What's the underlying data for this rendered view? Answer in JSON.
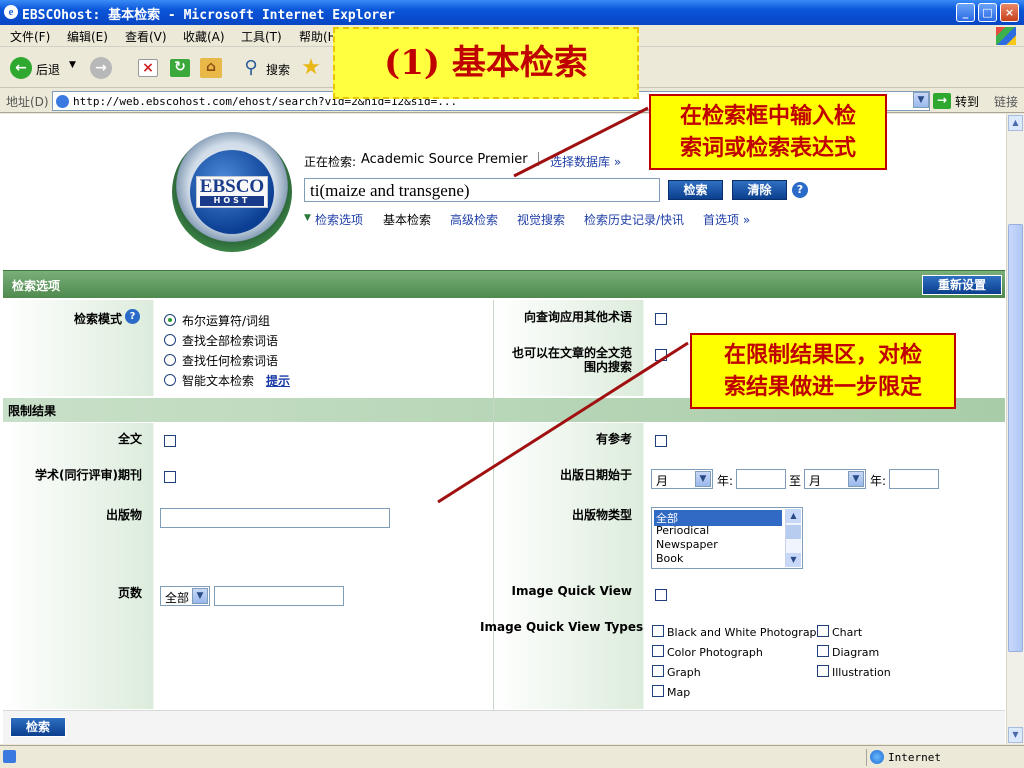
{
  "window": {
    "title": "EBSCOhost: 基本检索 - Microsoft Internet Explorer"
  },
  "menu": [
    "文件(F)",
    "编辑(E)",
    "查看(V)",
    "收藏(A)",
    "工具(T)",
    "帮助(H)"
  ],
  "toolbar": {
    "back": "后退",
    "search": "搜索"
  },
  "address": {
    "label": "地址(D)",
    "url": "http://web.ebscohost.com/ehost/search?vid=2&hid=12&sid=...",
    "go": "转到",
    "links": "链接"
  },
  "header": {
    "searching_label": "正在检索:",
    "database": "Academic Source Premier",
    "choose_db": "选择数据库 »",
    "query": "ti(maize and transgene)",
    "search_btn": "检索",
    "clear_btn": "清除",
    "help": "?",
    "nav": [
      "检索选项",
      "基本检索",
      "高级检索",
      "视觉搜索",
      "检索历史记录/快讯",
      "首选项 »"
    ]
  },
  "search_options": {
    "title": "检索选项",
    "reset": "重新设置",
    "mode_label": "检索模式",
    "modes": [
      "布尔运算符/词组",
      "查找全部检索词语",
      "查找任何检索词语",
      "智能文本检索"
    ],
    "hint": "提示",
    "apply_related": "向查询应用其他术语",
    "fulltext_search_1": "也可以在文章的全文范",
    "fulltext_search_2": "围内搜索"
  },
  "limits": {
    "title": "限制结果",
    "fulltext": "全文",
    "has_refs": "有参考",
    "peer_reviewed": "学术(同行评审)期刊",
    "pub_date": "出版日期始于",
    "month": "月",
    "year": "年:",
    "to": "至",
    "publication": "出版物",
    "pub_type": "出版物类型",
    "pub_types": [
      "全部",
      "Periodical",
      "Newspaper",
      "Book"
    ],
    "pages": "页数",
    "pages_select": "全部",
    "iqv": "Image Quick View",
    "iqv_types": "Image Quick View Types",
    "image_types": [
      "Black and White Photograph",
      "Chart",
      "Color Photograph",
      "Diagram",
      "Graph",
      "Illustration",
      "Map"
    ]
  },
  "bottom_search": "检索",
  "status": {
    "zone": "Internet"
  },
  "annotations": {
    "title": "(1) 基本检索",
    "callout1_l1": "在检索框中输入检",
    "callout1_l2": "索词或检索表达式",
    "callout2_l1": "在限制结果区，对检",
    "callout2_l2": "索结果做进一步限定"
  },
  "colors": {
    "title_bar": "#0a55d8",
    "green_band": "#5e9a5e",
    "callout_bg": "#ffff00",
    "callout_text": "#c00000",
    "button_blue": "#0b3f8e"
  }
}
